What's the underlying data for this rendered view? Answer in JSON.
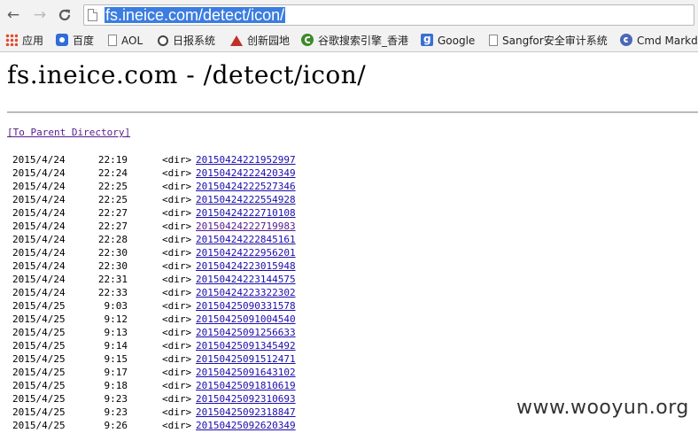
{
  "browser": {
    "url": "fs.ineice.com/detect/icon/",
    "nav": {
      "back": "←",
      "forward": "→",
      "reload": "C"
    }
  },
  "bookmarks": [
    {
      "label": "应用",
      "icon": "apps-grid-icon"
    },
    {
      "label": "百度",
      "icon": "baidu-paw-icon"
    },
    {
      "label": "AOL",
      "icon": "page-icon"
    },
    {
      "label": "日报系统",
      "icon": "rizhi-icon"
    },
    {
      "label": "创新园地",
      "icon": "chuangxin-icon"
    },
    {
      "label": "谷歌搜索引擎_香港",
      "icon": "google-search-icon"
    },
    {
      "label": "Google",
      "icon": "google-icon"
    },
    {
      "label": "Sangfor安全审计系统",
      "icon": "page-icon"
    },
    {
      "label": "Cmd Markd",
      "icon": "cmd-markdown-icon"
    }
  ],
  "page": {
    "heading": "fs.ineice.com - /detect/icon/",
    "parent_link": "[To Parent Directory]",
    "entries": [
      {
        "date": "2015/4/24",
        "time": "22:19",
        "type": "<dir>",
        "name": "20150424221952997",
        "visited": false
      },
      {
        "date": "2015/4/24",
        "time": "22:24",
        "type": "<dir>",
        "name": "20150424222420349",
        "visited": false
      },
      {
        "date": "2015/4/24",
        "time": "22:25",
        "type": "<dir>",
        "name": "20150424222527346",
        "visited": false
      },
      {
        "date": "2015/4/24",
        "time": "22:25",
        "type": "<dir>",
        "name": "20150424222554928",
        "visited": false
      },
      {
        "date": "2015/4/24",
        "time": "22:27",
        "type": "<dir>",
        "name": "20150424222710108",
        "visited": false
      },
      {
        "date": "2015/4/24",
        "time": "22:27",
        "type": "<dir>",
        "name": "20150424222719983",
        "visited": true
      },
      {
        "date": "2015/4/24",
        "time": "22:28",
        "type": "<dir>",
        "name": "20150424222845161",
        "visited": false
      },
      {
        "date": "2015/4/24",
        "time": "22:30",
        "type": "<dir>",
        "name": "20150424222956201",
        "visited": false
      },
      {
        "date": "2015/4/24",
        "time": "22:30",
        "type": "<dir>",
        "name": "20150424223015948",
        "visited": false
      },
      {
        "date": "2015/4/24",
        "time": "22:31",
        "type": "<dir>",
        "name": "20150424223144575",
        "visited": false
      },
      {
        "date": "2015/4/24",
        "time": "22:33",
        "type": "<dir>",
        "name": "20150424223322302",
        "visited": false
      },
      {
        "date": "2015/4/25",
        "time": "9:03",
        "type": "<dir>",
        "name": "20150425090331578",
        "visited": false
      },
      {
        "date": "2015/4/25",
        "time": "9:12",
        "type": "<dir>",
        "name": "20150425091004540",
        "visited": false
      },
      {
        "date": "2015/4/25",
        "time": "9:13",
        "type": "<dir>",
        "name": "20150425091256633",
        "visited": false
      },
      {
        "date": "2015/4/25",
        "time": "9:14",
        "type": "<dir>",
        "name": "20150425091345492",
        "visited": false
      },
      {
        "date": "2015/4/25",
        "time": "9:15",
        "type": "<dir>",
        "name": "20150425091512471",
        "visited": false
      },
      {
        "date": "2015/4/25",
        "time": "9:17",
        "type": "<dir>",
        "name": "20150425091643102",
        "visited": false
      },
      {
        "date": "2015/4/25",
        "time": "9:18",
        "type": "<dir>",
        "name": "20150425091810619",
        "visited": false
      },
      {
        "date": "2015/4/25",
        "time": "9:23",
        "type": "<dir>",
        "name": "20150425092310693",
        "visited": false
      },
      {
        "date": "2015/4/25",
        "time": "9:23",
        "type": "<dir>",
        "name": "20150425092318847",
        "visited": false
      },
      {
        "date": "2015/4/25",
        "time": "9:26",
        "type": "<dir>",
        "name": "20150425092620349",
        "visited": false
      }
    ]
  },
  "watermark": "www.wooyun.org",
  "colors": {
    "link": "#1a0dab",
    "visited_link": "#551a8b",
    "url_highlight": "#3b7de0"
  }
}
